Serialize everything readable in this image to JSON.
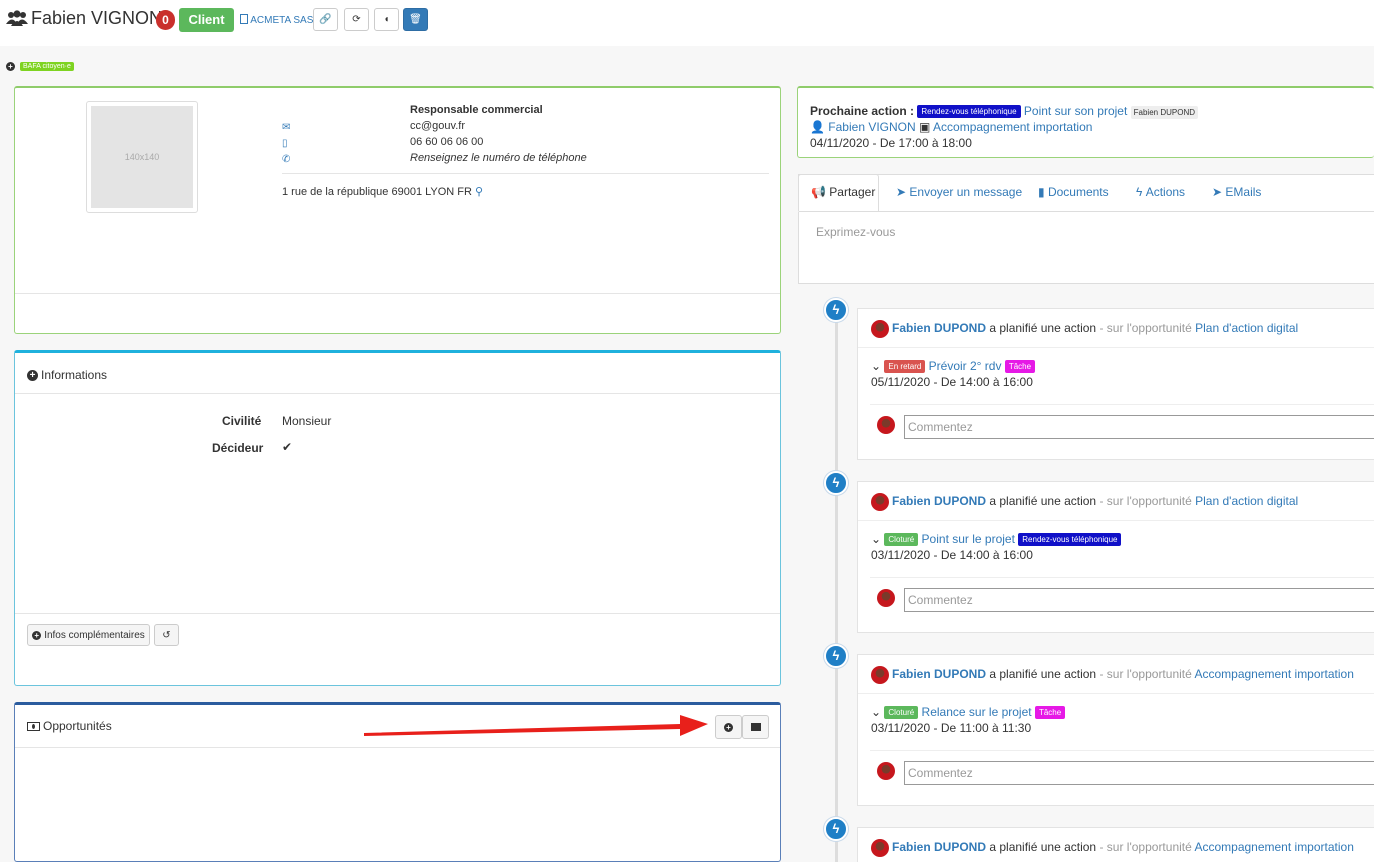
{
  "header": {
    "title": "Fabien VIGNON",
    "count": "0",
    "status": "Client",
    "company": "ACMETA SAS",
    "tag": "BAFA citoyen·e"
  },
  "contact": {
    "photo_placeholder": "140x140",
    "role": "Responsable commercial",
    "email": "cc@gouv.fr",
    "mobile": "06 60 06 06 00",
    "phone_placeholder": "Renseignez le numéro de téléphone",
    "address": "1 rue de la république 69001 LYON FR"
  },
  "informations": {
    "title": "Informations",
    "civility_label": "Civilité",
    "civility_value": "Monsieur",
    "decider_label": "Décideur",
    "more_button": "Infos complémentaires"
  },
  "opportunities": {
    "title": "Opportunités"
  },
  "next_action": {
    "label": "Prochaine action :",
    "type": "Rendez-vous téléphonique",
    "title": "Point sur son projet",
    "owner": "Fabien DUPOND",
    "contact": "Fabien VIGNON",
    "opportunity": "Accompagnement importation",
    "when": "04/11/2020 - De 17:00 à 18:00"
  },
  "tabs": {
    "share": "Partager",
    "message": "Envoyer un message",
    "documents": "Documents",
    "actions": "Actions",
    "emails": "EMails",
    "placeholder": "Exprimez-vous"
  },
  "feed": [
    {
      "author": "Fabien DUPOND",
      "verb": "a planifié une action",
      "prefix": "- sur l'opportunité",
      "opportunity": "Plan d'action digital",
      "status": "En retard",
      "action": "Prévoir 2° rdv",
      "kind": "Tâche",
      "when": "05/11/2020 - De 14:00 à 16:00",
      "comment_placeholder": "Commentez"
    },
    {
      "author": "Fabien DUPOND",
      "verb": "a planifié une action",
      "prefix": "- sur l'opportunité",
      "opportunity": "Plan d'action digital",
      "status": "Cloturé",
      "action": "Point sur le projet",
      "kind": "Rendez-vous téléphonique",
      "when": "03/11/2020 - De 14:00 à 16:00",
      "comment_placeholder": "Commentez"
    },
    {
      "author": "Fabien DUPOND",
      "verb": "a planifié une action",
      "prefix": "- sur l'opportunité",
      "opportunity": "Accompagnement importation",
      "status": "Cloturé",
      "action": "Relance sur le projet",
      "kind": "Tâche",
      "when": "03/11/2020 - De 11:00 à 11:30",
      "comment_placeholder": "Commentez"
    },
    {
      "author": "Fabien DUPOND",
      "verb": "a planifié une action",
      "prefix": "- sur l'opportunité",
      "opportunity": "Accompagnement importation"
    }
  ],
  "colors": {
    "primary": "#337ab7",
    "success": "#5cb85c",
    "danger": "#d9534f",
    "annotation_arrow": "#e8201b"
  }
}
